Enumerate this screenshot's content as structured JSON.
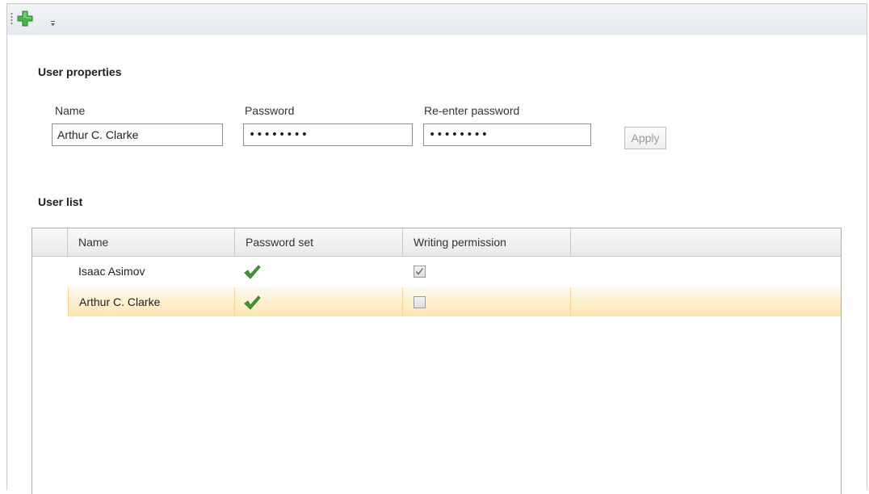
{
  "toolbar": {
    "add_icon": "add-icon",
    "overflow_icon": "overflow-chevron-icon"
  },
  "user_properties": {
    "title": "User properties",
    "name_label": "Name",
    "name_value": "Arthur C. Clarke",
    "password_label": "Password",
    "password_value": "••••••••",
    "reenter_label": "Re-enter password",
    "reenter_value": "••••••••",
    "apply_label": "Apply"
  },
  "user_list": {
    "title": "User list",
    "columns": [
      "Name",
      "Password set",
      "Writing permission"
    ],
    "rows": [
      {
        "name": "Isaac Asimov",
        "password_set": true,
        "writing_permission": true,
        "selected": false
      },
      {
        "name": "Arthur C. Clarke",
        "password_set": true,
        "writing_permission": false,
        "selected": true
      }
    ]
  },
  "colors": {
    "check_green": "#3f9a2f",
    "selection": "#fde6b0",
    "add_green": "#3cae3c"
  }
}
